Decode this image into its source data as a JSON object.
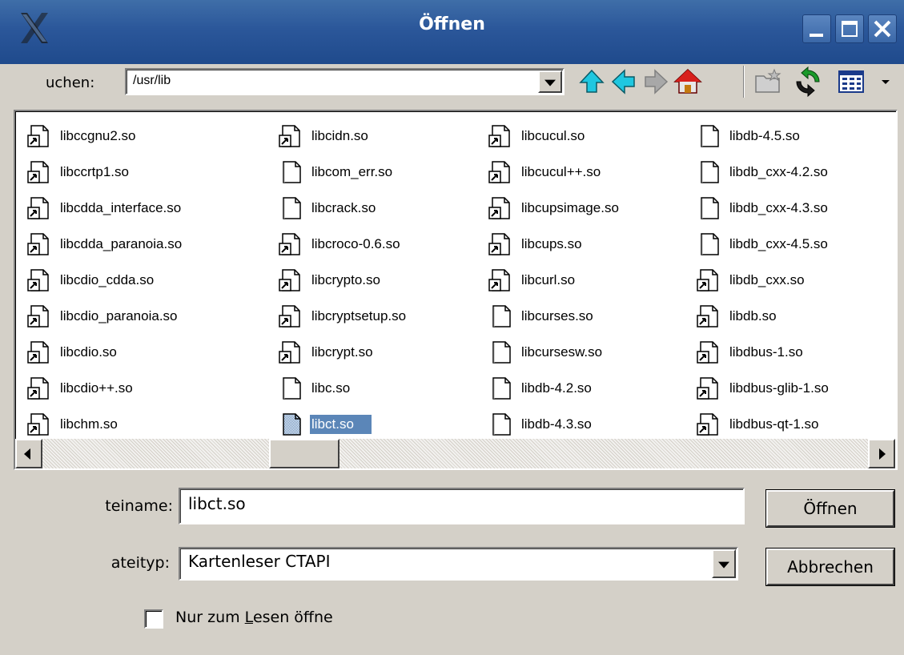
{
  "window": {
    "title": "Öffnen",
    "controls": {
      "minimize": "minimize",
      "maximize": "maximize",
      "close": "close"
    }
  },
  "lookin": {
    "label": "uchen:",
    "path": "/usr/lib"
  },
  "toolbar": {
    "icons": [
      "up-arrow-icon",
      "back-arrow-icon",
      "forward-arrow-icon",
      "home-icon",
      "new-folder-icon",
      "refresh-icon",
      "view-mode-icon",
      "dropdown-icon"
    ]
  },
  "files": {
    "columns": [
      [
        {
          "name": "libccgnu2.so",
          "type": "link"
        },
        {
          "name": "libccrtp1.so",
          "type": "link"
        },
        {
          "name": "libcdda_interface.so",
          "type": "link"
        },
        {
          "name": "libcdda_paranoia.so",
          "type": "link"
        },
        {
          "name": "libcdio_cdda.so",
          "type": "link"
        },
        {
          "name": "libcdio_paranoia.so",
          "type": "link"
        },
        {
          "name": "libcdio.so",
          "type": "link"
        },
        {
          "name": "libcdio++.so",
          "type": "link"
        },
        {
          "name": "libchm.so",
          "type": "link"
        }
      ],
      [
        {
          "name": "libcidn.so",
          "type": "link"
        },
        {
          "name": "libcom_err.so",
          "type": "file"
        },
        {
          "name": "libcrack.so",
          "type": "file"
        },
        {
          "name": "libcroco-0.6.so",
          "type": "link"
        },
        {
          "name": "libcrypto.so",
          "type": "link"
        },
        {
          "name": "libcryptsetup.so",
          "type": "link"
        },
        {
          "name": "libcrypt.so",
          "type": "link"
        },
        {
          "name": "libc.so",
          "type": "file"
        },
        {
          "name": "libct.so",
          "type": "file",
          "selected": true
        }
      ],
      [
        {
          "name": "libcucul.so",
          "type": "link"
        },
        {
          "name": "libcucul++.so",
          "type": "link"
        },
        {
          "name": "libcupsimage.so",
          "type": "link"
        },
        {
          "name": "libcups.so",
          "type": "link"
        },
        {
          "name": "libcurl.so",
          "type": "link"
        },
        {
          "name": "libcurses.so",
          "type": "file"
        },
        {
          "name": "libcursesw.so",
          "type": "file"
        },
        {
          "name": "libdb-4.2.so",
          "type": "file"
        },
        {
          "name": "libdb-4.3.so",
          "type": "file"
        }
      ],
      [
        {
          "name": "libdb-4.5.so",
          "type": "file"
        },
        {
          "name": "libdb_cxx-4.2.so",
          "type": "file"
        },
        {
          "name": "libdb_cxx-4.3.so",
          "type": "file"
        },
        {
          "name": "libdb_cxx-4.5.so",
          "type": "file"
        },
        {
          "name": "libdb_cxx.so",
          "type": "link"
        },
        {
          "name": "libdb.so",
          "type": "link"
        },
        {
          "name": "libdbus-1.so",
          "type": "link"
        },
        {
          "name": "libdbus-glib-1.so",
          "type": "link"
        },
        {
          "name": "libdbus-qt-1.so",
          "type": "link"
        }
      ]
    ]
  },
  "scrollbar": {
    "position": 0.3
  },
  "filename": {
    "label": "teiname:",
    "value": "libct.so"
  },
  "filetype": {
    "label": "ateityp:",
    "value": "Kartenleser CTAPI"
  },
  "buttons": {
    "open": "Öffnen",
    "cancel": "Abbrechen"
  },
  "readonly": {
    "prefix": "Nur zum ",
    "accel": "L",
    "suffix": "esen öffne",
    "checked": false
  },
  "colors": {
    "titlebar": "#2b579a",
    "selection": "#5b86b8",
    "face": "#d4d0c8"
  }
}
